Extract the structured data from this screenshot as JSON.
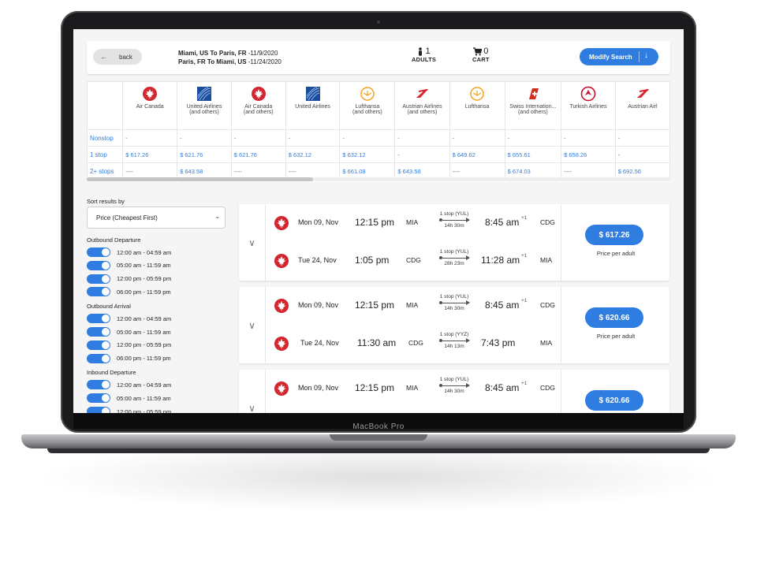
{
  "device": {
    "label": "MacBook Pro"
  },
  "header": {
    "back_label": "back",
    "outbound_route": "Miami, US To Paris, FR",
    "outbound_date": " -11/9/2020",
    "inbound_route": "Paris, FR To Miami, US",
    "inbound_date": " -11/24/2020",
    "adults_count": "1",
    "adults_label": "ADULTS",
    "cart_count": "0",
    "cart_label": "CART",
    "modify_label": "Modify Search"
  },
  "matrix": {
    "airlines": [
      {
        "name": "Air Canada",
        "sub": "",
        "logo": "air-canada-logo"
      },
      {
        "name": "United Airlines",
        "sub": "(and others)",
        "logo": "united-logo"
      },
      {
        "name": "Air Canada",
        "sub": "(and others)",
        "logo": "air-canada-logo"
      },
      {
        "name": "United Airlines",
        "sub": "",
        "logo": "united-logo"
      },
      {
        "name": "Lufthansa",
        "sub": "(and others)",
        "logo": "lufthansa-logo"
      },
      {
        "name": "Austrian Airlines",
        "sub": "(and others)",
        "logo": "austrian-logo"
      },
      {
        "name": "Lufthansa",
        "sub": "",
        "logo": "lufthansa-logo"
      },
      {
        "name": "Swiss Internation...",
        "sub": "(and others)",
        "logo": "swiss-logo"
      },
      {
        "name": "Turkish Airlines",
        "sub": "",
        "logo": "turkish-logo"
      },
      {
        "name": "Austrian Airl",
        "sub": "",
        "logo": "austrian-logo"
      }
    ],
    "rows": [
      {
        "label": "Nonstop",
        "values": [
          "-",
          "-",
          "-",
          "-",
          "-",
          "-",
          "-",
          "-",
          "-",
          "-"
        ]
      },
      {
        "label": "1 stop",
        "values": [
          "$ 617.26",
          "$ 621.76",
          "$ 621.76",
          "$ 632.12",
          "$ 632.12",
          "-",
          "$ 649.62",
          "$ 655.61",
          "$ 658.26",
          "-"
        ]
      },
      {
        "label": "2+ stops",
        "values": [
          "----",
          "$ 643.58",
          "----",
          "----",
          "$ 661.08",
          "$ 643.58",
          "----",
          "$ 674.03",
          "----",
          "$ 692.56"
        ]
      }
    ]
  },
  "filters": {
    "sort_label": "Sort results by",
    "sort_value": "Price (Cheapest First)",
    "groups": [
      {
        "title": "Outbound Departure",
        "options": [
          "12:00 am - 04:59 am",
          "05:00 am - 11:59 am",
          "12:00 pm - 05:59 pm",
          "06:00 pm - 11:59 pm"
        ]
      },
      {
        "title": "Outbound Arrival",
        "options": [
          "12:00 am - 04:59 am",
          "05:00 am - 11:59 am",
          "12:00 pm - 05:59 pm",
          "06:00 pm - 11:59 pm"
        ]
      },
      {
        "title": "Inbound Departure",
        "options": [
          "12:00 am - 04:59 am",
          "05:00 am - 11:59 am",
          "12:00 pm - 05:59 pm"
        ]
      }
    ]
  },
  "results": [
    {
      "price": "$ 617.26",
      "per": "Price per adult",
      "legs": [
        {
          "date": "Mon 09, Nov",
          "dep": "12:15 pm",
          "from": "MIA",
          "stops": "1 stop (YUL)",
          "dur": "14h 30m",
          "arr": "8:45 am",
          "plus": "+1",
          "to": "CDG"
        },
        {
          "date": "Tue 24, Nov",
          "dep": "1:05 pm",
          "from": "CDG",
          "stops": "1 stop (YUL)",
          "dur": "28h 23m",
          "arr": "11:28 am",
          "plus": "+1",
          "to": "MIA"
        }
      ]
    },
    {
      "price": "$ 620.66",
      "per": "Price per adult",
      "legs": [
        {
          "date": "Mon 09, Nov",
          "dep": "12:15 pm",
          "from": "MIA",
          "stops": "1 stop (YUL)",
          "dur": "14h 30m",
          "arr": "8:45 am",
          "plus": "+1",
          "to": "CDG"
        },
        {
          "date": "Tue 24, Nov",
          "dep": "11:30 am",
          "from": "CDG",
          "stops": "1 stop (YYZ)",
          "dur": "14h 13m",
          "arr": "7:43 pm",
          "plus": "",
          "to": "MIA"
        }
      ]
    },
    {
      "price": "$ 620.66",
      "per": "",
      "legs": [
        {
          "date": "Mon 09, Nov",
          "dep": "12:15 pm",
          "from": "MIA",
          "stops": "1 stop (YUL)",
          "dur": "14h 30m",
          "arr": "8:45 am",
          "plus": "+1",
          "to": "CDG"
        }
      ]
    }
  ],
  "colors": {
    "accent": "#2f7de1",
    "air_canada": "#d22630"
  }
}
